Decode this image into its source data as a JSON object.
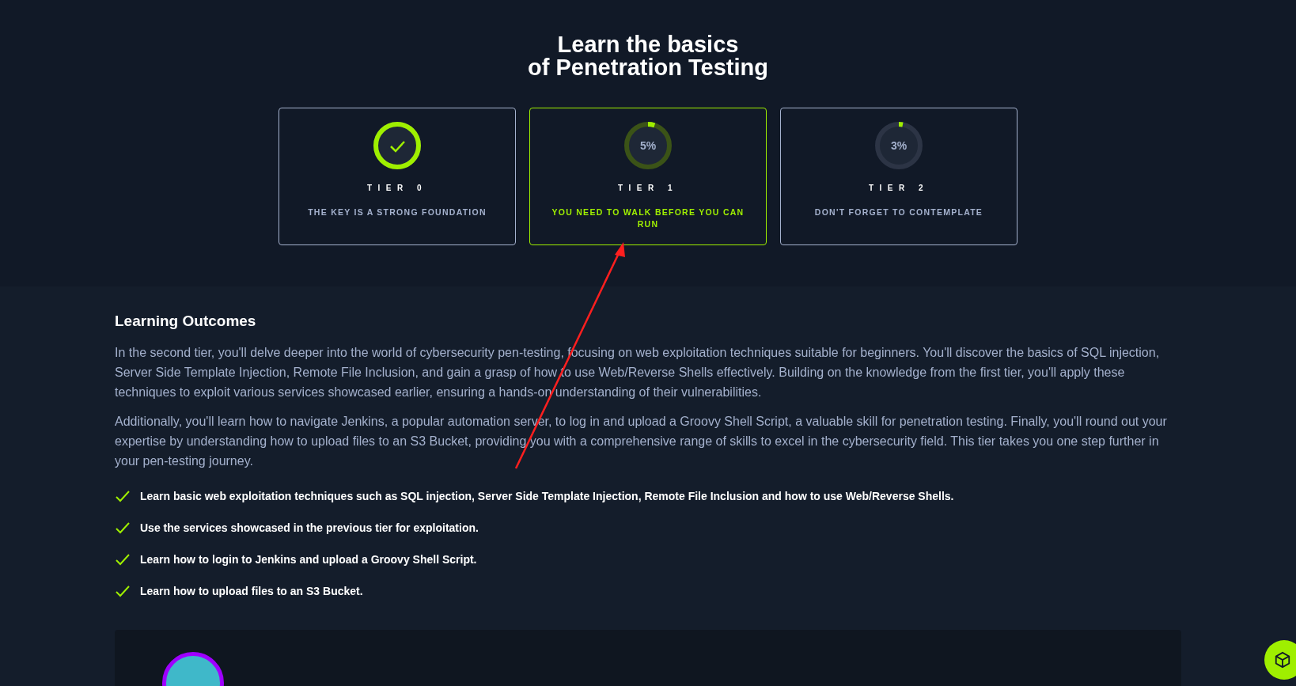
{
  "hero": {
    "title_lines": [
      "Learn the basics",
      "of Penetration Testing"
    ],
    "tiers": [
      {
        "kind": "complete",
        "label": "TIER 0",
        "subtitle": "THE KEY IS A STRONG FOUNDATION",
        "selected": false,
        "level": 1
      },
      {
        "kind": "progress",
        "label": "TIER 1",
        "subtitle": "YOU NEED TO WALK BEFORE YOU CAN RUN",
        "selected": true,
        "level": 0.05,
        "percent": "5%"
      },
      {
        "kind": "progress",
        "label": "TIER 2",
        "subtitle": "DON'T FORGET TO CONTEMPLATE",
        "selected": false,
        "level": 0.03,
        "percent": "3%"
      }
    ]
  },
  "outcomes": {
    "heading": "Learning Outcomes",
    "paragraphs": [
      "In the second tier, you'll delve deeper into the world of cybersecurity pen-testing, focusing on web exploitation techniques suitable for beginners. You'll discover the basics of SQL injection, Server Side Template Injection, Remote File Inclusion, and gain a grasp of how to use Web/Reverse Shells effectively. Building on the knowledge from the first tier, you'll apply these techniques to exploit various services showcased earlier, ensuring a hands-on understanding of their vulnerabilities.",
      "Additionally, you'll learn how to navigate Jenkins, a popular automation server, to log in and upload a Groovy Shell Script, a valuable skill for penetration testing. Finally, you'll round out your expertise by understanding how to upload files to an S3 Bucket, providing you with a comprehensive range of skills to excel in the cybersecurity field. This tier takes you one step further in your pen-testing journey."
    ],
    "checklist": [
      "Learn basic web exploitation techniques such as SQL injection, Server Side Template Injection, Remote File Inclusion and how to use Web/Reverse Shells.",
      "Use the services showcased in the previous tier for exploitation.",
      "Learn how to login to Jenkins and upload a Groovy Shell Script.",
      "Learn how to upload files to an S3 Bucket."
    ]
  }
}
